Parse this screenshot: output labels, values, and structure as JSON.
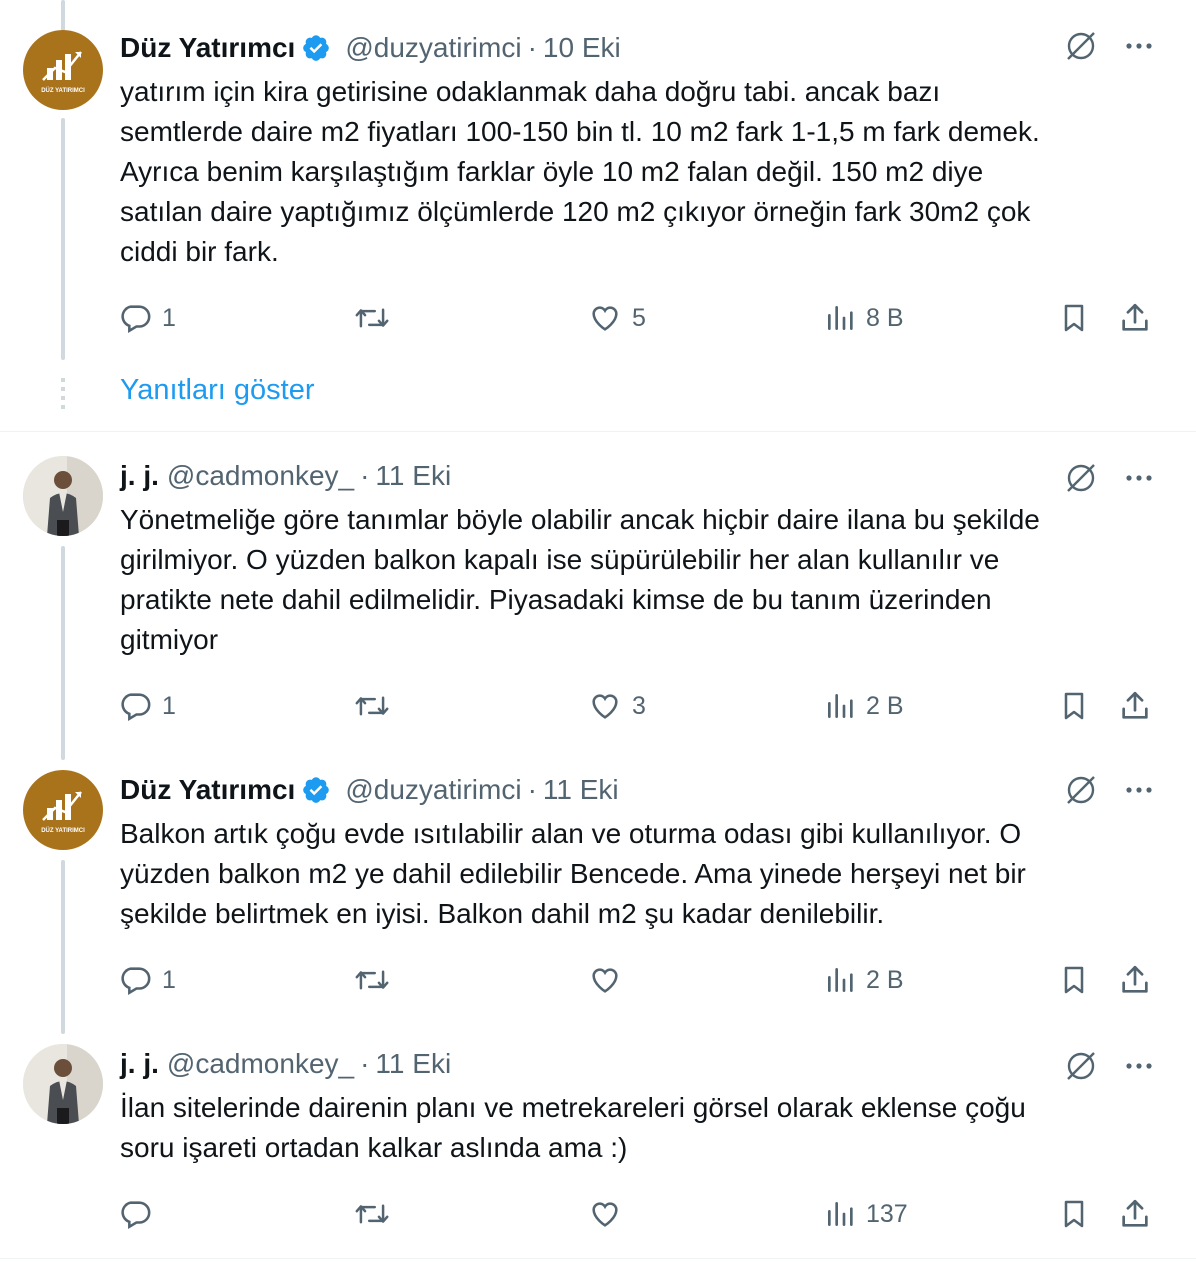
{
  "tweets": [
    {
      "name": "Düz Yatırımcı",
      "verified": true,
      "handle": "@duzyatirimci",
      "date": "10 Eki",
      "text": "yatırım için kira getirisine odaklanmak daha doğru tabi. ancak bazı\nsemtlerde daire m2 fiyatları 100-150 bin tl. 10 m2 fark 1-1,5 m fark demek.\nAyrıca benim karşılaştığım farklar öyle 10 m2 falan değil. 150 m2 diye\nsatılan daire yaptığımız ölçümlerde 120 m2 çıkıyor örneğin fark 30m2 çok\nciddi bir fark.",
      "replies": "1",
      "reposts": "",
      "likes": "5",
      "views": "8 B",
      "avatar_text": "DÜZ YATIRIMCI"
    },
    {
      "name": "j. j.",
      "verified": false,
      "handle": "@cadmonkey_",
      "date": "11 Eki",
      "text": "Yönetmeliğe göre tanımlar böyle olabilir ancak hiçbir daire ilana bu şekilde\ngirilmiyor. O yüzden balkon kapalı ise süpürülebilir her alan kullanılır ve\npratikte nete dahil edilmelidir. Piyasadaki kimse de bu tanım üzerinden\ngitmiyor",
      "replies": "1",
      "reposts": "",
      "likes": "3",
      "views": "2 B"
    },
    {
      "name": "Düz Yatırımcı",
      "verified": true,
      "handle": "@duzyatirimci",
      "date": "11 Eki",
      "text": "Balkon artık çoğu evde ısıtılabilir alan ve oturma odası gibi kullanılıyor. O\nyüzden balkon m2 ye dahil edilebilir Bencede. Ama yinede herşeyi net bir\nşekilde belirtmek en iyisi. Balkon dahil m2 şu kadar denilebilir.",
      "replies": "1",
      "reposts": "",
      "likes": "",
      "views": "2 B",
      "avatar_text": "DÜZ YATIRIMCI"
    },
    {
      "name": "j. j.",
      "verified": false,
      "handle": "@cadmonkey_",
      "date": "11 Eki",
      "text": "İlan sitelerinde dairenin planı ve metrekareleri görsel olarak eklense çoğu\nsoru işareti ortadan kalkar aslında ama :)",
      "replies": "",
      "reposts": "",
      "likes": "",
      "views": "137"
    }
  ],
  "show_replies": "Yanıtları göster",
  "separator": "·",
  "colors": {
    "accent": "#1d9bf0",
    "muted": "#536471",
    "text": "#0f1419",
    "verified": "#1d9bf0",
    "duz_avatar": "#a9731c"
  },
  "icons": [
    "verified-badge-icon",
    "grok-icon",
    "more-icon",
    "reply-icon",
    "repost-icon",
    "like-icon",
    "views-icon",
    "bookmark-icon",
    "share-icon"
  ]
}
